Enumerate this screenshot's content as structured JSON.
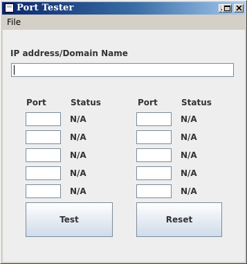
{
  "window": {
    "title": "Port  Tester"
  },
  "menu": {
    "file": "File"
  },
  "ip": {
    "label": "IP address/Domain Name",
    "value": ""
  },
  "left": {
    "port_header": "Port",
    "status_header": "Status",
    "rows": [
      {
        "port": "",
        "status": "N/A"
      },
      {
        "port": "",
        "status": "N/A"
      },
      {
        "port": "",
        "status": "N/A"
      },
      {
        "port": "",
        "status": "N/A"
      },
      {
        "port": "",
        "status": "N/A"
      }
    ]
  },
  "right": {
    "port_header": "Port",
    "status_header": "Status",
    "rows": [
      {
        "port": "",
        "status": "N/A"
      },
      {
        "port": "",
        "status": "N/A"
      },
      {
        "port": "",
        "status": "N/A"
      },
      {
        "port": "",
        "status": "N/A"
      },
      {
        "port": "",
        "status": "N/A"
      }
    ]
  },
  "buttons": {
    "test": "Test",
    "reset": "Reset"
  },
  "icons": {
    "app": "app-window-icon",
    "minimize": "minimize-icon",
    "maximize": "maximize-icon",
    "close": "close-icon"
  }
}
